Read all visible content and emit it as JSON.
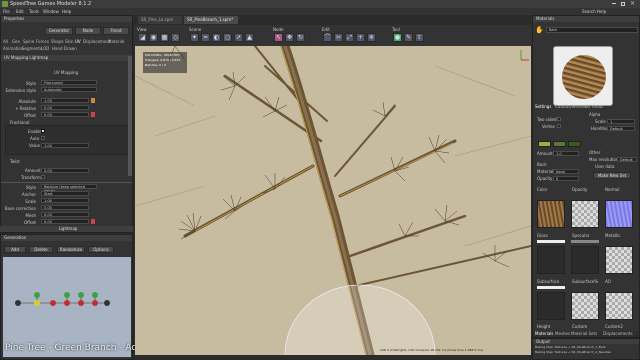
{
  "app": {
    "title": "SpeedTree Games Modeler 8.1.2"
  },
  "menu": [
    "File",
    "Edit",
    "Tools",
    "Window",
    "Help"
  ],
  "search_label": "Search Help",
  "properties": {
    "title": "Properties",
    "generator_btn": "Generator",
    "node_btn": "Node",
    "frond_btn": "Frond",
    "tabs_row1": [
      "All",
      "Gen",
      "Spine",
      "Forces",
      "Shape",
      "Skin",
      "UV",
      "Displacement",
      "Material"
    ],
    "tabs_row2": [
      "Animation",
      "Segments",
      "LOD",
      "Hand Drawn"
    ],
    "section": "UV Mapping Lightmap",
    "subsection": "UV Mapping",
    "rows": [
      {
        "label": "Style",
        "value": "Fine-tuned"
      },
      {
        "label": "Extension style",
        "value": "Automatic"
      },
      {
        "label": "Absolute",
        "value": "1.00"
      },
      {
        "label": "+ Relative",
        "value": "0.00"
      },
      {
        "label": "Offset",
        "value": "0.00"
      }
    ],
    "fractional": {
      "label": "Fractional",
      "enable": "Enable",
      "auto": "Auto",
      "value_label": "Value",
      "value": "1.00"
    },
    "twist": {
      "label": "Twist",
      "amount_label": "Amount",
      "amount": "0.00",
      "transform": "Transform"
    },
    "lower_rows": [
      {
        "label": "Style",
        "value": "Relative (keep selected value)"
      },
      {
        "label": "Anchor",
        "value": "Start"
      },
      {
        "label": "Scale",
        "value": "1.00"
      },
      {
        "label": "Base correction",
        "value": "0.00"
      },
      {
        "label": "Mesh",
        "value": "0.00"
      },
      {
        "label": "Offset",
        "value": "0.00"
      }
    ],
    "lightmap": "Lightmap"
  },
  "generation": {
    "title": "Generation",
    "add": "Add",
    "delete": "Delete",
    "randomize": "Randomize",
    "options": "Options",
    "caption": "Pine Tree - Green Branch - Adding Texture"
  },
  "viewport": {
    "tabs": [
      "SR_Pine_Lo.spm",
      "SR_PineBranch_1.spm*"
    ],
    "tool_groups": [
      "View",
      "Scene",
      "Node",
      "Edit",
      "Tool"
    ],
    "info_line1": "POLYGONS - SELECTED",
    "info_line2": "Triangles: 9,879 / 9,879",
    "info_line3": "Batches: 9 / 9",
    "status": "LOD 0 (Fullbright), LOD Compute 18,791 ms (Draw time 1,088.5 ms)",
    "colors": {
      "ground": "#c8bca0",
      "bark": "#6b5535",
      "twig": "#4a3825",
      "highlight": "#d9b84a"
    }
  },
  "materials": {
    "title": "Materials",
    "search_label": "Search Help",
    "material_name": "Bark",
    "tabs": [
      "Settings",
      "Cutouts/Meshes",
      "UV Areas"
    ],
    "two_sided": "Two sided",
    "vertex_label": "Vertex",
    "alpha": "Alpha",
    "scale_label": "Scale",
    "scale_val": "1",
    "handling_label": "Handling",
    "handling_val": "Default",
    "amount_label": "Amount",
    "amount_val": "1.0",
    "back": "Back",
    "material_label": "Material",
    "material_val": "None",
    "opacity_label": "Opacity",
    "opacity_val": "0",
    "other": "Other",
    "max_res_label": "Max resolution",
    "max_res_val": "Default",
    "user_data": "User data",
    "make_new": "Make New Set",
    "maps": [
      "Color",
      "Opacity",
      "Normal",
      "Gloss",
      "Specular",
      "Metallic",
      "Subsurface",
      "Subsurface%",
      "AO",
      "Height",
      "Custom",
      "Custom2"
    ],
    "bottom_tabs": [
      "Materials",
      "Meshes",
      "Material Sets",
      "Displacements"
    ]
  },
  "output": {
    "title": "Output",
    "lines": [
      "Baking Map: Textures + SR_PineBranch_1_Bark",
      "Baking Map: Textures + SR_PineBranch_1_Needles"
    ]
  }
}
